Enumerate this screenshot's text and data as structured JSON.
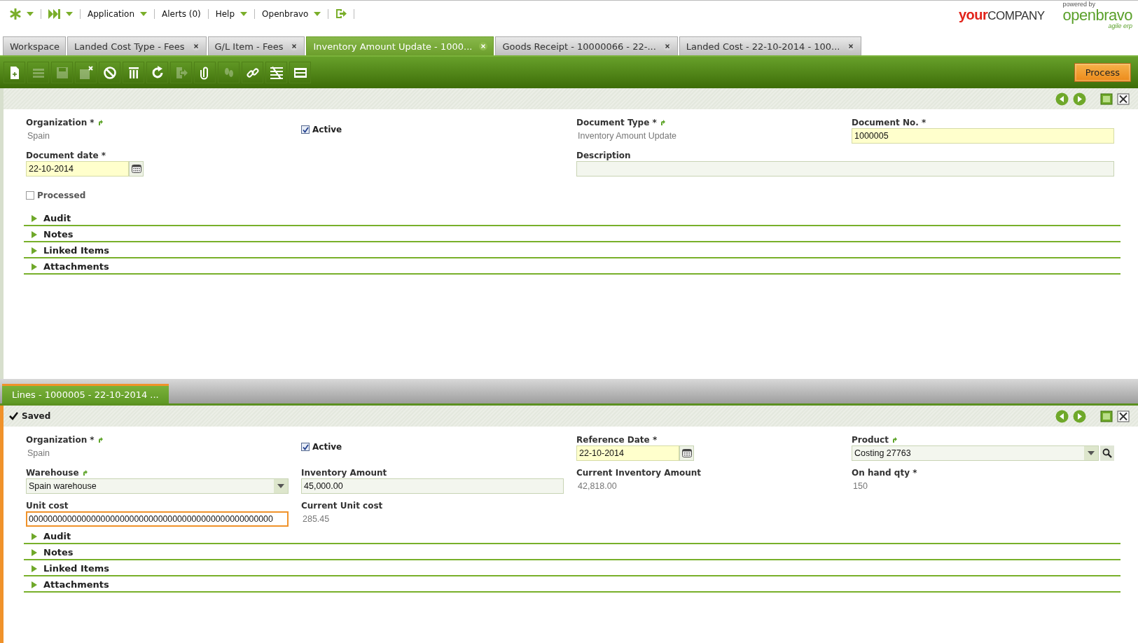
{
  "top_bar": {
    "menus": [
      {
        "label": "Application",
        "dropdown": true
      },
      {
        "label": "Alerts (0)",
        "dropdown": false
      },
      {
        "label": "Help",
        "dropdown": true
      },
      {
        "label": "Openbravo",
        "dropdown": true
      }
    ],
    "company_logo": {
      "first": "your",
      "second": "COMPANY"
    },
    "vendor_logo": {
      "caption": "powered by",
      "name": "openbravo",
      "tagline": "agile erp"
    }
  },
  "tabs": [
    {
      "label": "Workspace",
      "closable": false,
      "selected": false
    },
    {
      "label": "Landed Cost Type - Fees",
      "closable": true,
      "selected": false
    },
    {
      "label": "G/L Item - Fees",
      "closable": true,
      "selected": false
    },
    {
      "label": "Inventory Amount Update - 1000...",
      "closable": true,
      "selected": true
    },
    {
      "label": "Goods Receipt - 10000066 - 22-...",
      "closable": true,
      "selected": false
    },
    {
      "label": "Landed Cost - 22-10-2014 - 100...",
      "closable": true,
      "selected": false
    }
  ],
  "toolbar": {
    "buttons": [
      {
        "kind": "new",
        "disabled": false
      },
      {
        "kind": "grid",
        "disabled": true
      },
      {
        "kind": "save",
        "disabled": true
      },
      {
        "kind": "save-close",
        "disabled": false
      },
      {
        "kind": "undo",
        "disabled": false
      },
      {
        "kind": "delete",
        "disabled": false
      },
      {
        "kind": "refresh",
        "disabled": false
      },
      {
        "kind": "export",
        "disabled": true
      },
      {
        "kind": "attach",
        "disabled": false
      },
      {
        "kind": "audit",
        "disabled": true
      },
      {
        "kind": "link",
        "disabled": false
      },
      {
        "kind": "tools",
        "disabled": false
      },
      {
        "kind": "toggle",
        "disabled": false
      }
    ],
    "process_button": "Process"
  },
  "header_form": {
    "rows": [
      [
        {
          "kind": "readonly",
          "label": "Organization *",
          "link": true,
          "value": "Spain"
        },
        {
          "kind": "checkbox",
          "label": "Active",
          "checked": true
        },
        {
          "kind": "readonly",
          "label": "Document Type *",
          "link": true,
          "value": "Inventory Amount Update"
        },
        {
          "kind": "text",
          "label": "Document No. *",
          "required": true,
          "value": "1000005"
        }
      ],
      [
        {
          "kind": "date",
          "label": "Document date *",
          "required": true,
          "value": "22-10-2014"
        },
        null,
        {
          "kind": "wide",
          "label": "Description",
          "required": false
        }
      ],
      [
        {
          "kind": "checkbox",
          "label": "Processed",
          "checked": false
        }
      ]
    ],
    "sections": [
      {
        "label": "Audit",
        "expanded": false
      },
      {
        "label": "Notes",
        "expanded": false
      },
      {
        "label": "Linked Items",
        "expanded": false
      },
      {
        "label": "Attachments",
        "expanded": false
      }
    ]
  },
  "lines_tab": {
    "label": "Lines - 1000005 - 22-10-2014 ..."
  },
  "lines_form": {
    "status": "Saved",
    "rows": [
      [
        {
          "kind": "readonly",
          "label": "Organization *",
          "link": true,
          "value": "Spain"
        },
        {
          "kind": "checkbox",
          "label": "Active",
          "checked": true
        },
        {
          "kind": "date",
          "label": "Reference Date *",
          "required": true,
          "value": "22-10-2014"
        },
        {
          "kind": "search-select",
          "label": "Product",
          "link": true,
          "value": "Costing 27763"
        }
      ],
      [
        {
          "kind": "select",
          "label": "Warehouse",
          "link": true,
          "value": "Spain warehouse"
        },
        {
          "kind": "text",
          "label": "Inventory Amount",
          "required": false,
          "value": "45,000.00"
        },
        {
          "kind": "readonly",
          "label": "Current Inventory Amount",
          "link": false,
          "value": "42,818.00"
        },
        {
          "kind": "readonly",
          "label": "On hand qty *",
          "link": false,
          "value": "150"
        }
      ],
      [
        {
          "kind": "text",
          "label": "Unit cost",
          "required": false,
          "focused": true,
          "value": "000000000000000000000000000000000000000000000000000"
        },
        {
          "kind": "readonly",
          "label": "Current Unit cost",
          "link": false,
          "value": "285.45"
        }
      ]
    ],
    "sections": [
      {
        "label": "Audit",
        "expanded": false
      },
      {
        "label": "Notes",
        "expanded": false
      },
      {
        "label": "Linked Items",
        "expanded": false
      },
      {
        "label": "Attachments",
        "expanded": false
      }
    ]
  }
}
